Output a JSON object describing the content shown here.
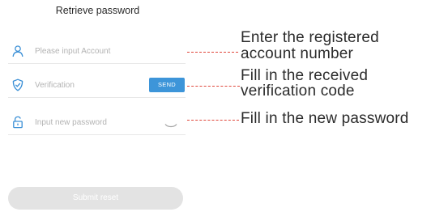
{
  "page": {
    "title": "Retrieve password"
  },
  "form": {
    "account_placeholder": "Please input Account",
    "verification_placeholder": "Verification",
    "send_label": "SEND",
    "password_placeholder": "Input new password",
    "submit_label": "Submit reset"
  },
  "annotations": {
    "account_line1": "Enter the registered",
    "account_line2": "account number",
    "verification_line1": "Fill in the received",
    "verification_line2": "verification code",
    "password_line1": "Fill in the new password"
  },
  "icons": {
    "account": "user-icon",
    "verification": "shield-check-icon",
    "password": "lock-icon",
    "eye": "eye-closed-icon"
  },
  "colors": {
    "accent": "#3d95d9",
    "icon": "#3a8fd6",
    "annotation_line": "#e0473b",
    "submit_disabled": "#e3e3e3"
  }
}
